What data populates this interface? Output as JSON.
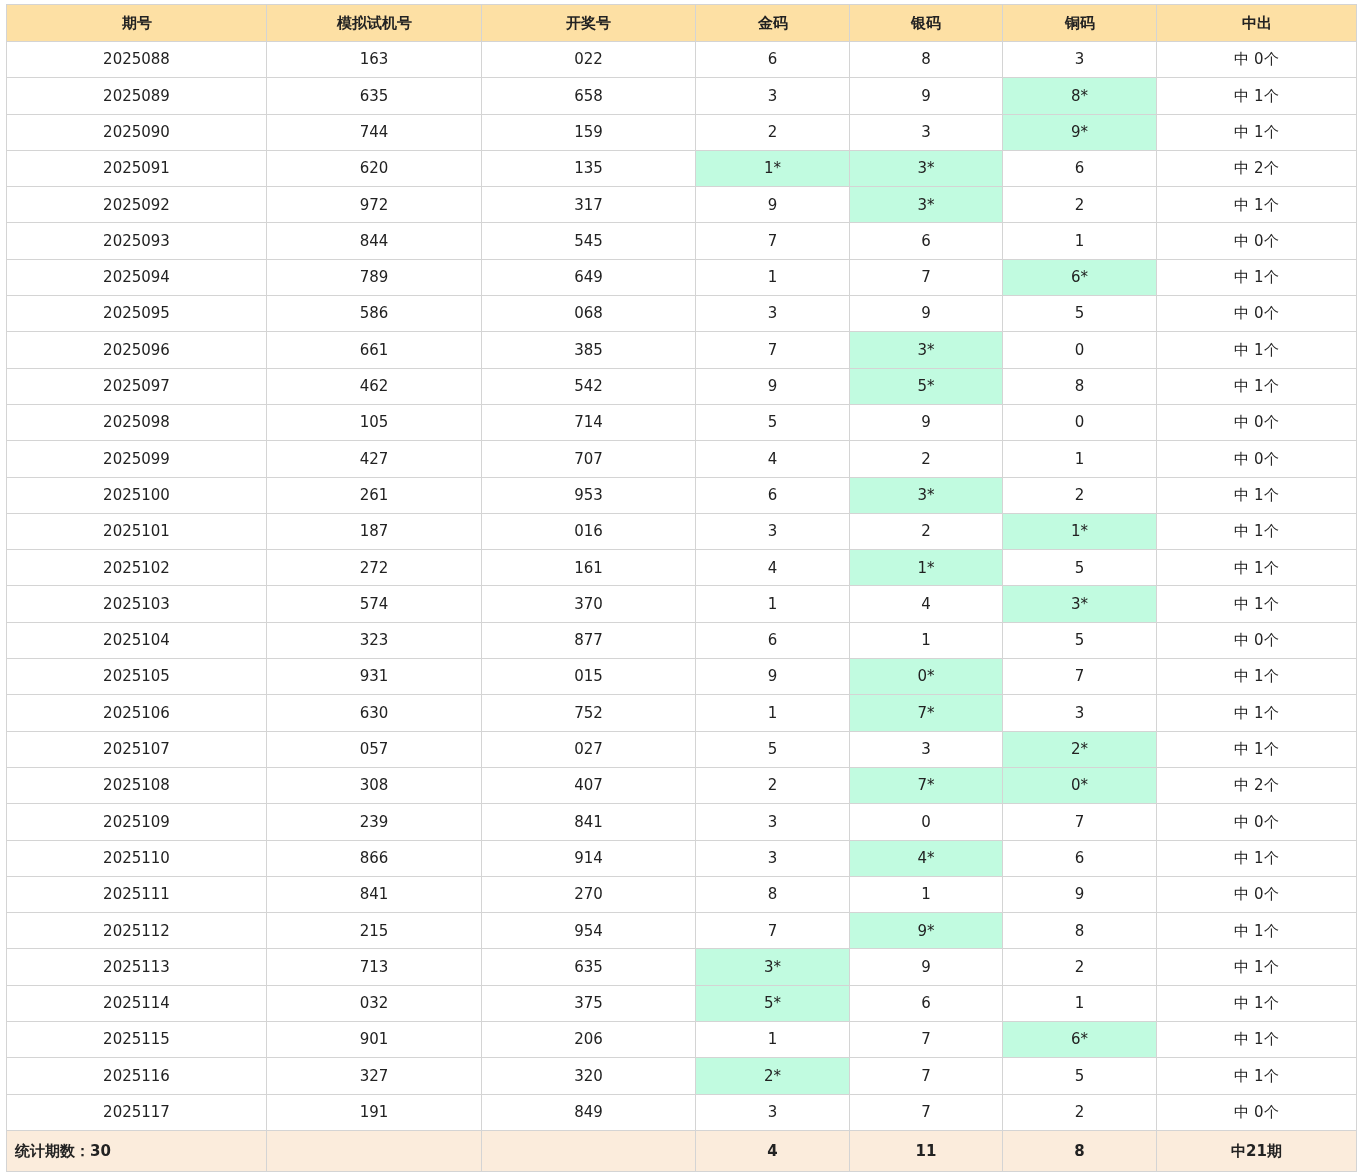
{
  "columns": [
    "期号",
    "模拟试机号",
    "开奖号",
    "金码",
    "银码",
    "铜码",
    "中出"
  ],
  "rows": [
    {
      "issue": "2025088",
      "sim": "163",
      "draw": "022",
      "codes": [
        {
          "text": "6",
          "hit": false
        },
        {
          "text": "8",
          "hit": false
        },
        {
          "text": "3",
          "hit": false
        }
      ],
      "result": "中 0个"
    },
    {
      "issue": "2025089",
      "sim": "635",
      "draw": "658",
      "codes": [
        {
          "text": "3",
          "hit": false
        },
        {
          "text": "9",
          "hit": false
        },
        {
          "text": "8*",
          "hit": true
        }
      ],
      "result": "中 1个"
    },
    {
      "issue": "2025090",
      "sim": "744",
      "draw": "159",
      "codes": [
        {
          "text": "2",
          "hit": false
        },
        {
          "text": "3",
          "hit": false
        },
        {
          "text": "9*",
          "hit": true
        }
      ],
      "result": "中 1个"
    },
    {
      "issue": "2025091",
      "sim": "620",
      "draw": "135",
      "codes": [
        {
          "text": "1*",
          "hit": true
        },
        {
          "text": "3*",
          "hit": true
        },
        {
          "text": "6",
          "hit": false
        }
      ],
      "result": "中 2个"
    },
    {
      "issue": "2025092",
      "sim": "972",
      "draw": "317",
      "codes": [
        {
          "text": "9",
          "hit": false
        },
        {
          "text": "3*",
          "hit": true
        },
        {
          "text": "2",
          "hit": false
        }
      ],
      "result": "中 1个"
    },
    {
      "issue": "2025093",
      "sim": "844",
      "draw": "545",
      "codes": [
        {
          "text": "7",
          "hit": false
        },
        {
          "text": "6",
          "hit": false
        },
        {
          "text": "1",
          "hit": false
        }
      ],
      "result": "中 0个"
    },
    {
      "issue": "2025094",
      "sim": "789",
      "draw": "649",
      "codes": [
        {
          "text": "1",
          "hit": false
        },
        {
          "text": "7",
          "hit": false
        },
        {
          "text": "6*",
          "hit": true
        }
      ],
      "result": "中 1个"
    },
    {
      "issue": "2025095",
      "sim": "586",
      "draw": "068",
      "codes": [
        {
          "text": "3",
          "hit": false
        },
        {
          "text": "9",
          "hit": false
        },
        {
          "text": "5",
          "hit": false
        }
      ],
      "result": "中 0个"
    },
    {
      "issue": "2025096",
      "sim": "661",
      "draw": "385",
      "codes": [
        {
          "text": "7",
          "hit": false
        },
        {
          "text": "3*",
          "hit": true
        },
        {
          "text": "0",
          "hit": false
        }
      ],
      "result": "中 1个"
    },
    {
      "issue": "2025097",
      "sim": "462",
      "draw": "542",
      "codes": [
        {
          "text": "9",
          "hit": false
        },
        {
          "text": "5*",
          "hit": true
        },
        {
          "text": "8",
          "hit": false
        }
      ],
      "result": "中 1个"
    },
    {
      "issue": "2025098",
      "sim": "105",
      "draw": "714",
      "codes": [
        {
          "text": "5",
          "hit": false
        },
        {
          "text": "9",
          "hit": false
        },
        {
          "text": "0",
          "hit": false
        }
      ],
      "result": "中 0个"
    },
    {
      "issue": "2025099",
      "sim": "427",
      "draw": "707",
      "codes": [
        {
          "text": "4",
          "hit": false
        },
        {
          "text": "2",
          "hit": false
        },
        {
          "text": "1",
          "hit": false
        }
      ],
      "result": "中 0个"
    },
    {
      "issue": "2025100",
      "sim": "261",
      "draw": "953",
      "codes": [
        {
          "text": "6",
          "hit": false
        },
        {
          "text": "3*",
          "hit": true
        },
        {
          "text": "2",
          "hit": false
        }
      ],
      "result": "中 1个"
    },
    {
      "issue": "2025101",
      "sim": "187",
      "draw": "016",
      "codes": [
        {
          "text": "3",
          "hit": false
        },
        {
          "text": "2",
          "hit": false
        },
        {
          "text": "1*",
          "hit": true
        }
      ],
      "result": "中 1个"
    },
    {
      "issue": "2025102",
      "sim": "272",
      "draw": "161",
      "codes": [
        {
          "text": "4",
          "hit": false
        },
        {
          "text": "1*",
          "hit": true
        },
        {
          "text": "5",
          "hit": false
        }
      ],
      "result": "中 1个"
    },
    {
      "issue": "2025103",
      "sim": "574",
      "draw": "370",
      "codes": [
        {
          "text": "1",
          "hit": false
        },
        {
          "text": "4",
          "hit": false
        },
        {
          "text": "3*",
          "hit": true
        }
      ],
      "result": "中 1个"
    },
    {
      "issue": "2025104",
      "sim": "323",
      "draw": "877",
      "codes": [
        {
          "text": "6",
          "hit": false
        },
        {
          "text": "1",
          "hit": false
        },
        {
          "text": "5",
          "hit": false
        }
      ],
      "result": "中 0个"
    },
    {
      "issue": "2025105",
      "sim": "931",
      "draw": "015",
      "codes": [
        {
          "text": "9",
          "hit": false
        },
        {
          "text": "0*",
          "hit": true
        },
        {
          "text": "7",
          "hit": false
        }
      ],
      "result": "中 1个"
    },
    {
      "issue": "2025106",
      "sim": "630",
      "draw": "752",
      "codes": [
        {
          "text": "1",
          "hit": false
        },
        {
          "text": "7*",
          "hit": true
        },
        {
          "text": "3",
          "hit": false
        }
      ],
      "result": "中 1个"
    },
    {
      "issue": "2025107",
      "sim": "057",
      "draw": "027",
      "codes": [
        {
          "text": "5",
          "hit": false
        },
        {
          "text": "3",
          "hit": false
        },
        {
          "text": "2*",
          "hit": true
        }
      ],
      "result": "中 1个"
    },
    {
      "issue": "2025108",
      "sim": "308",
      "draw": "407",
      "codes": [
        {
          "text": "2",
          "hit": false
        },
        {
          "text": "7*",
          "hit": true
        },
        {
          "text": "0*",
          "hit": true
        }
      ],
      "result": "中 2个"
    },
    {
      "issue": "2025109",
      "sim": "239",
      "draw": "841",
      "codes": [
        {
          "text": "3",
          "hit": false
        },
        {
          "text": "0",
          "hit": false
        },
        {
          "text": "7",
          "hit": false
        }
      ],
      "result": "中 0个"
    },
    {
      "issue": "2025110",
      "sim": "866",
      "draw": "914",
      "codes": [
        {
          "text": "3",
          "hit": false
        },
        {
          "text": "4*",
          "hit": true
        },
        {
          "text": "6",
          "hit": false
        }
      ],
      "result": "中 1个"
    },
    {
      "issue": "2025111",
      "sim": "841",
      "draw": "270",
      "codes": [
        {
          "text": "8",
          "hit": false
        },
        {
          "text": "1",
          "hit": false
        },
        {
          "text": "9",
          "hit": false
        }
      ],
      "result": "中 0个"
    },
    {
      "issue": "2025112",
      "sim": "215",
      "draw": "954",
      "codes": [
        {
          "text": "7",
          "hit": false
        },
        {
          "text": "9*",
          "hit": true
        },
        {
          "text": "8",
          "hit": false
        }
      ],
      "result": "中 1个"
    },
    {
      "issue": "2025113",
      "sim": "713",
      "draw": "635",
      "codes": [
        {
          "text": "3*",
          "hit": true
        },
        {
          "text": "9",
          "hit": false
        },
        {
          "text": "2",
          "hit": false
        }
      ],
      "result": "中 1个"
    },
    {
      "issue": "2025114",
      "sim": "032",
      "draw": "375",
      "codes": [
        {
          "text": "5*",
          "hit": true
        },
        {
          "text": "6",
          "hit": false
        },
        {
          "text": "1",
          "hit": false
        }
      ],
      "result": "中 1个"
    },
    {
      "issue": "2025115",
      "sim": "901",
      "draw": "206",
      "codes": [
        {
          "text": "1",
          "hit": false
        },
        {
          "text": "7",
          "hit": false
        },
        {
          "text": "6*",
          "hit": true
        }
      ],
      "result": "中 1个"
    },
    {
      "issue": "2025116",
      "sim": "327",
      "draw": "320",
      "codes": [
        {
          "text": "2*",
          "hit": true
        },
        {
          "text": "7",
          "hit": false
        },
        {
          "text": "5",
          "hit": false
        }
      ],
      "result": "中 1个"
    },
    {
      "issue": "2025117",
      "sim": "191",
      "draw": "849",
      "codes": [
        {
          "text": "3",
          "hit": false
        },
        {
          "text": "7",
          "hit": false
        },
        {
          "text": "2",
          "hit": false
        }
      ],
      "result": "中 0个"
    }
  ],
  "footer": {
    "label": "统计期数：30",
    "totals": [
      "4",
      "11",
      "8"
    ],
    "result": "中21期"
  }
}
